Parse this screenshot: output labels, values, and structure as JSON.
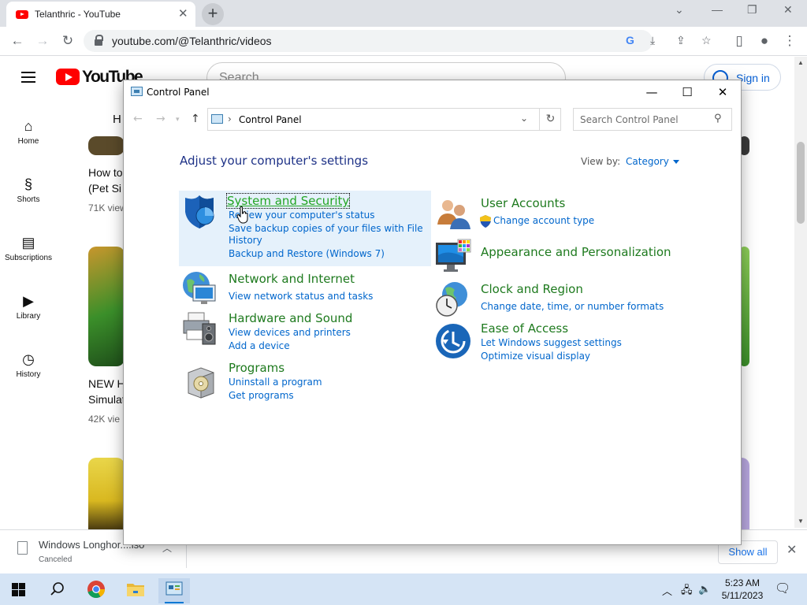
{
  "browser": {
    "tab_title": "Telanthric - YouTube",
    "new_tab_label": "+",
    "url": "youtube.com/@Telanthric/videos"
  },
  "youtube": {
    "logo_text": "YouTube",
    "search_placeholder": "Search",
    "sign_in": "Sign in",
    "sidebar": [
      {
        "label": "Home",
        "icon": "home-icon"
      },
      {
        "label": "Shorts",
        "icon": "shorts-icon"
      },
      {
        "label": "Subscriptions",
        "icon": "subscriptions-icon"
      },
      {
        "label": "Library",
        "icon": "library-icon"
      },
      {
        "label": "History",
        "icon": "history-icon"
      }
    ],
    "videos": [
      {
        "title_line1": "How to",
        "title_line2": "(Pet Si",
        "meta": "71K view"
      },
      {
        "title_line1": "NEW H",
        "title_line2": "Simulat",
        "meta": "42K vie"
      }
    ],
    "tab_fragment": "H"
  },
  "downloads": {
    "file_name": "Windows Longhor....iso",
    "status": "Canceled",
    "show_all": "Show all"
  },
  "taskbar": {
    "time": "5:23 AM",
    "date": "5/11/2023"
  },
  "control_panel": {
    "window_title": "Control Panel",
    "breadcrumb": "Control Panel",
    "search_placeholder": "Search Control Panel",
    "heading": "Adjust your computer's settings",
    "view_by_label": "View by:",
    "view_by_value": "Category",
    "categories": {
      "system": {
        "title": "System and Security",
        "links": [
          "Review your computer's status",
          "Save backup copies of your files with File",
          "History",
          "Backup and Restore (Windows 7)"
        ]
      },
      "network": {
        "title": "Network and Internet",
        "links": [
          "View network status and tasks"
        ]
      },
      "hardware": {
        "title": "Hardware and Sound",
        "links": [
          "View devices and printers",
          "Add a device"
        ]
      },
      "programs": {
        "title": "Programs",
        "links": [
          "Uninstall a program",
          "Get programs"
        ]
      },
      "users": {
        "title": "User Accounts",
        "links": [
          "Change account type"
        ]
      },
      "appearance": {
        "title": "Appearance and Personalization",
        "links": []
      },
      "clock": {
        "title": "Clock and Region",
        "links": [
          "Change date, time, or number formats"
        ]
      },
      "ease": {
        "title": "Ease of Access",
        "links": [
          "Let Windows suggest settings",
          "Optimize visual display"
        ]
      }
    }
  },
  "colors": {
    "cp_title_green": "#1e7a1e",
    "cp_link_blue": "#0066cc",
    "cp_heading_blue": "#1e3287",
    "hover_bg": "#e5f1fb",
    "youtube_red": "#ff0000",
    "taskbar_bg": "#d5e4f5"
  }
}
